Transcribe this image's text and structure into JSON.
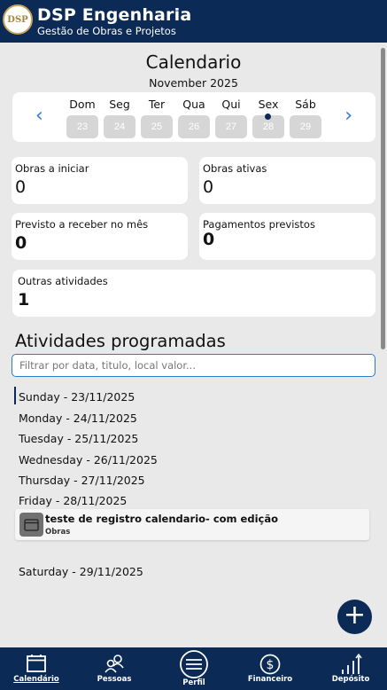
{
  "header": {
    "logo_text": "DSP",
    "title": "DSP Engenharia",
    "subtitle": "Gestão de Obras e Projetos"
  },
  "calendar": {
    "title": "Calendario",
    "month": "November 2025",
    "days": [
      {
        "name": "Dom",
        "num": "23"
      },
      {
        "name": "Seg",
        "num": "24"
      },
      {
        "name": "Ter",
        "num": "25"
      },
      {
        "name": "Qua",
        "num": "26"
      },
      {
        "name": "Qui",
        "num": "27"
      },
      {
        "name": "Sex",
        "num": "28"
      },
      {
        "name": "Sáb",
        "num": "29"
      }
    ],
    "prev_icon": "chevron-left-icon",
    "next_icon": "chevron-right-icon"
  },
  "stats": {
    "obras_a_iniciar": {
      "label": "Obras a iniciar",
      "value": "0"
    },
    "obras_ativas": {
      "label": "Obras ativas",
      "value": "0"
    },
    "previsto_receber": {
      "label": "Previsto a receber no mês",
      "value": "0"
    },
    "pagamentos_previstos": {
      "label": "Pagamentos previstos",
      "value": "0"
    },
    "outras_atividades": {
      "label": "Outras atividades",
      "value": "1"
    }
  },
  "activities": {
    "title": "Atividades programadas",
    "filter_placeholder": "Filtrar por data, titulo, local valor...",
    "dates": [
      "Sunday - 23/11/2025",
      "Monday - 24/11/2025",
      "Tuesday - 25/11/2025",
      "Wednesday - 26/11/2025",
      "Thursday - 27/11/2025",
      "Friday - 28/11/2025",
      "Saturday - 29/11/2025"
    ],
    "event": {
      "title": "teste de registro calendario- com edição",
      "category": "Obras"
    }
  },
  "fab": {
    "label": "+"
  },
  "nav": [
    {
      "label": "Calendário",
      "icon": "calendar-icon"
    },
    {
      "label": "Pessoas",
      "icon": "people-icon"
    },
    {
      "label": "Perfil",
      "icon": "menu-icon"
    },
    {
      "label": "Financeiro",
      "icon": "dollar-icon"
    },
    {
      "label": "Depósito",
      "icon": "bar-chart-icon"
    }
  ],
  "colors": {
    "primary": "#0b2a55",
    "accent": "#2d7bd1",
    "background": "#e9e9e9"
  }
}
